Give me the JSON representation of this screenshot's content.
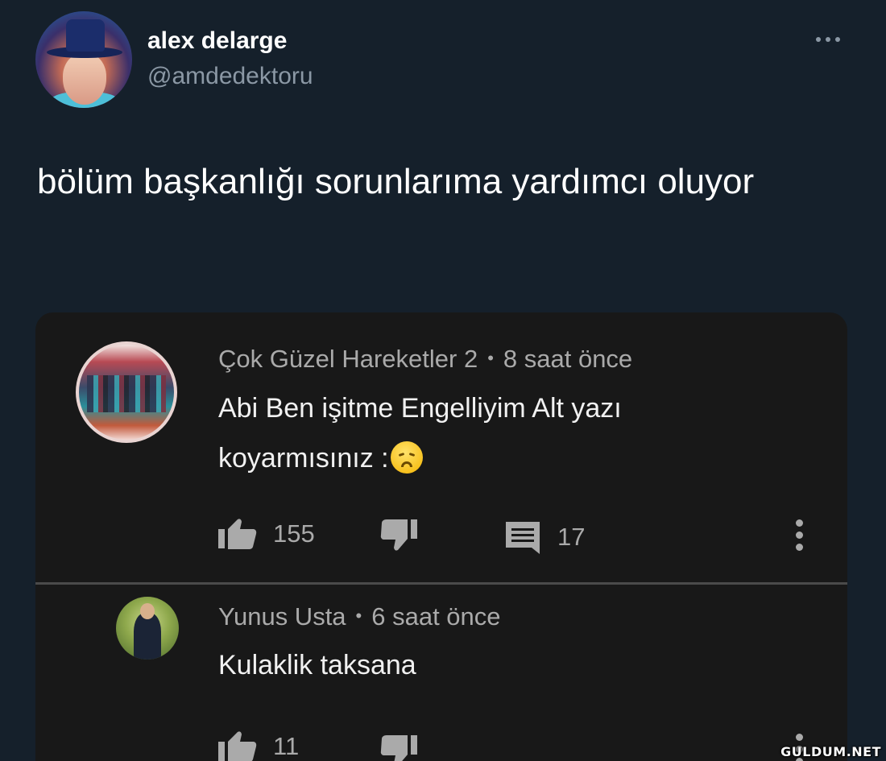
{
  "tweet": {
    "display_name": "alex delarge",
    "handle": "@amdedektoru",
    "text": "bölüm başkanlığı sorunlarıma yardımcı oluyor",
    "more_icon": "ellipsis-icon"
  },
  "embedded_comments": [
    {
      "author": "Çok Güzel Hareketler 2",
      "separator": "•",
      "time": "8 saat önce",
      "text": "Abi Ben işitme Engelliyim Alt yazı koyarmısınız :",
      "emoji": "disappointed-face-emoji",
      "likes": "155",
      "replies": "17"
    },
    {
      "author": "Yunus Usta",
      "separator": "•",
      "time": "6 saat önce",
      "text": "Kulaklik taksana",
      "likes": "11"
    }
  ],
  "colors": {
    "background": "#15202b",
    "embed_background": "#181818",
    "muted_text": "#aaaaaa",
    "handle_text": "#8b98a5"
  },
  "watermark": "GULDUM.NET"
}
